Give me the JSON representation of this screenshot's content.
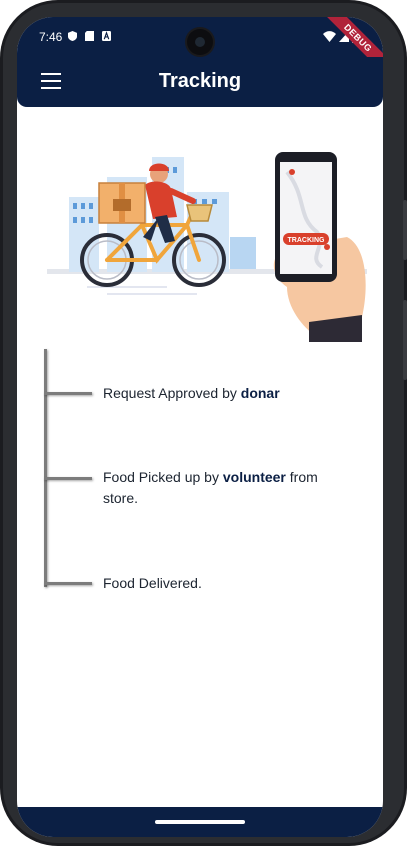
{
  "status_bar": {
    "time": "7:46",
    "debug_label": "DEBUG"
  },
  "app_bar": {
    "title": "Tracking"
  },
  "illustration": {
    "phone_badge": "TRACKING"
  },
  "timeline": {
    "steps": [
      {
        "prefix": "Request Approved by ",
        "bold": "donar",
        "suffix": ""
      },
      {
        "prefix": "Food Picked up by ",
        "bold": "volunteer",
        "suffix": " from store."
      },
      {
        "prefix": "Food Delivered.",
        "bold": "",
        "suffix": ""
      }
    ]
  },
  "colors": {
    "primary": "#0b1f44",
    "timeline_line": "#7c7c7c",
    "accent": "#c62828"
  }
}
